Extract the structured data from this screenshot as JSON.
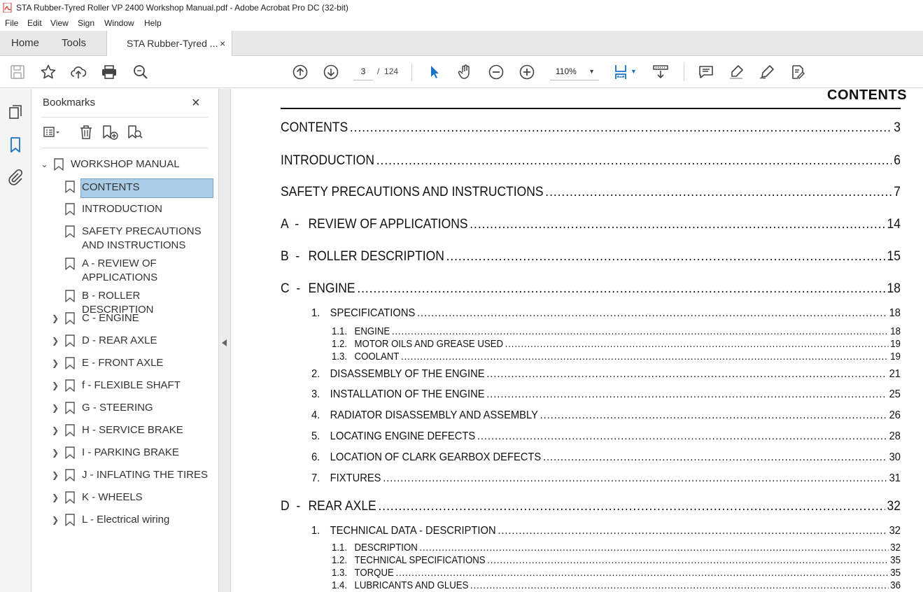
{
  "window": {
    "title": "STA Rubber-Tyred Roller VP 2400 Workshop Manual.pdf - Adobe Acrobat Pro DC (32-bit)"
  },
  "menu": [
    "File",
    "Edit",
    "View",
    "Sign",
    "Window",
    "Help"
  ],
  "tabs": {
    "home": "Home",
    "tools": "Tools",
    "document": "STA Rubber-Tyred ...",
    "close": "×"
  },
  "toolbar": {
    "current_page": "3",
    "page_separator": "/",
    "total_pages": "124",
    "zoom": "110%",
    "icons": [
      "save-icon",
      "star-icon",
      "upload-icon",
      "print-icon",
      "search-icon",
      "page-up-icon",
      "page-down-icon",
      "select-cursor-icon",
      "hand-icon",
      "zoom-out-icon",
      "zoom-in-icon",
      "fit-page-icon",
      "scroll-mode-icon",
      "comment-icon",
      "highlight-icon",
      "sign-icon",
      "redact-icon"
    ]
  },
  "bookmarks": {
    "title": "Bookmarks",
    "close": "×",
    "items": [
      {
        "label": "WORKSHOP MANUAL",
        "expandable": true,
        "expanded": true
      },
      {
        "label": "CONTENTS",
        "selected": true
      },
      {
        "label": "INTRODUCTION"
      },
      {
        "label": "SAFETY PRECAUTIONS AND INSTRUCTIONS"
      },
      {
        "label": "A - REVIEW OF APPLICATIONS"
      },
      {
        "label": "B - ROLLER DESCRIPTION"
      },
      {
        "label": "C - ENGINE",
        "expandable": true
      },
      {
        "label": "D - REAR AXLE",
        "expandable": true
      },
      {
        "label": "E - FRONT AXLE",
        "expandable": true
      },
      {
        "label": "f - FLEXIBLE SHAFT",
        "expandable": true
      },
      {
        "label": "G - STEERING",
        "expandable": true
      },
      {
        "label": "H - SERVICE BRAKE",
        "expandable": true
      },
      {
        "label": "I - PARKING BRAKE",
        "expandable": true
      },
      {
        "label": "J - INFLATING THE TIRES",
        "expandable": true
      },
      {
        "label": "K - WHEELS",
        "expandable": true
      },
      {
        "label": "L - Electrical wiring",
        "expandable": true
      }
    ]
  },
  "document": {
    "header": "CONTENTS",
    "entries": [
      {
        "level": 1,
        "num": "",
        "label": "CONTENTS",
        "page": "3"
      },
      {
        "level": 1,
        "num": "",
        "label": "INTRODUCTION",
        "page": "6"
      },
      {
        "level": 1,
        "num": "",
        "label": "SAFETY PRECAUTIONS AND INSTRUCTIONS",
        "page": "7"
      },
      {
        "level": 1,
        "num": "A  -",
        "label": "REVIEW OF APPLICATIONS",
        "page": "14"
      },
      {
        "level": 1,
        "num": "B  -",
        "label": "ROLLER DESCRIPTION",
        "page": "15"
      },
      {
        "level": 1,
        "num": "C  -",
        "label": "ENGINE",
        "page": "18"
      },
      {
        "level": 2,
        "num": "1.",
        "label": "SPECIFICATIONS",
        "page": "18"
      },
      {
        "level": 3,
        "num": "1.1.",
        "label": "ENGINE",
        "page": "18"
      },
      {
        "level": 3,
        "num": "1.2.",
        "label": "MOTOR OILS AND GREASE USED",
        "page": "19"
      },
      {
        "level": 3,
        "num": "1.3.",
        "label": "COOLANT",
        "page": "19"
      },
      {
        "level": 2,
        "num": "2.",
        "label": "DISASSEMBLY OF THE ENGINE",
        "page": "21"
      },
      {
        "level": 2,
        "num": "3.",
        "label": "INSTALLATION OF THE ENGINE",
        "page": "25"
      },
      {
        "level": 2,
        "num": "4.",
        "label": "RADIATOR DISASSEMBLY AND ASSEMBLY",
        "page": "26"
      },
      {
        "level": 2,
        "num": "5.",
        "label": "LOCATING ENGINE DEFECTS",
        "page": "28"
      },
      {
        "level": 2,
        "num": "6.",
        "label": "LOCATION OF CLARK GEARBOX DEFECTS",
        "page": "30"
      },
      {
        "level": 2,
        "num": "7.",
        "label": "FIXTURES",
        "page": "31"
      },
      {
        "level": 1,
        "num": "D  -",
        "label": "REAR AXLE",
        "page": "32"
      },
      {
        "level": 2,
        "num": "1.",
        "label": "TECHNICAL DATA - DESCRIPTION",
        "page": "32"
      },
      {
        "level": 3,
        "num": "1.1.",
        "label": "DESCRIPTION",
        "page": "32"
      },
      {
        "level": 3,
        "num": "1.2.",
        "label": "TECHNICAL SPECIFICATIONS",
        "page": "35"
      },
      {
        "level": 3,
        "num": "1.3.",
        "label": "TORQUE",
        "page": "35"
      },
      {
        "level": 3,
        "num": "1.4.",
        "label": "LUBRICANTS AND GLUES",
        "page": "36"
      }
    ]
  },
  "colors": {
    "selection": "#a9cce7",
    "accent_blue": "#1a73c8",
    "pdf_red": "#d4301f"
  }
}
